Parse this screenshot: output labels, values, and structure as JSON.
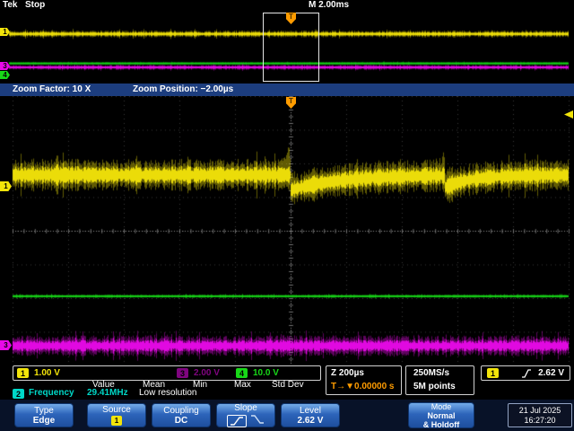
{
  "header": {
    "logo": "Tek",
    "status": "Stop",
    "timebase": "M 2.00ms"
  },
  "zoom_bar": {
    "factor": "Zoom Factor: 10 X",
    "position": "Zoom Position: −2.00µs"
  },
  "trigger_flag": "T",
  "channel_scales": {
    "ch1_num": "1",
    "ch1_scale": "1.00 V",
    "ch3_num": "3",
    "ch3_scale": "2.00 V",
    "ch4_num": "4",
    "ch4_scale": "10.0 V"
  },
  "markers": {
    "ch1": "1",
    "ch3": "3",
    "ch4": "4"
  },
  "measurements": {
    "headers": {
      "value": "Value",
      "mean": "Mean",
      "min": "Min",
      "max": "Max",
      "stddev": "Std Dev"
    },
    "row": {
      "ch": "2",
      "name": "Frequency",
      "value": "29.41MHz",
      "note": "Low resolution"
    }
  },
  "horizontal": {
    "zoom_scale": "Z 200µs",
    "delay": "T→▼0.00000 s",
    "rate": "250MS/s",
    "points": "5M points"
  },
  "trigger": {
    "ch": "1",
    "level": "2.62 V"
  },
  "menu": {
    "type": {
      "title": "Type",
      "value": "Edge"
    },
    "source": {
      "title": "Source",
      "value": "1"
    },
    "coupling": {
      "title": "Coupling",
      "value": "DC"
    },
    "slope": {
      "title": "Slope"
    },
    "level": {
      "title": "Level",
      "value": "2.62 V"
    },
    "mode": {
      "title": "Mode",
      "value1": "Normal",
      "value2": "& Holdoff"
    }
  },
  "datetime": {
    "date": "21 Jul 2025",
    "time": "16:27:20"
  },
  "colors": {
    "ch1": "#f2e40a",
    "ch2": "#00d8c8",
    "ch3": "#e80ae8",
    "ch4": "#18d818",
    "trigger_orange": "#ff9c00",
    "menu_blue": "#2d64ba",
    "zoombar_blue": "#1c3d7e"
  },
  "waveforms": {
    "colors": {
      "ch1": "#f2e40a",
      "ch3": "#e80ae8",
      "ch4": "#18d818"
    },
    "overview": {
      "ch1_y": 0.31,
      "ch4_y": 0.72,
      "ch3_y": 0.775
    },
    "zoom": {
      "ch1_center": 0.293,
      "ch1_amp": 14,
      "ch1_transients": [
        {
          "x": 0.505,
          "dip": 17,
          "recover": 55,
          "spike": 16
        },
        {
          "x": 0.775,
          "dip": 13,
          "recover": 28,
          "spike": 8
        }
      ],
      "ch4_center": 0.743,
      "ch4_amp": 1.6,
      "ch3_center": 0.927,
      "ch3_amp": 9
    }
  }
}
